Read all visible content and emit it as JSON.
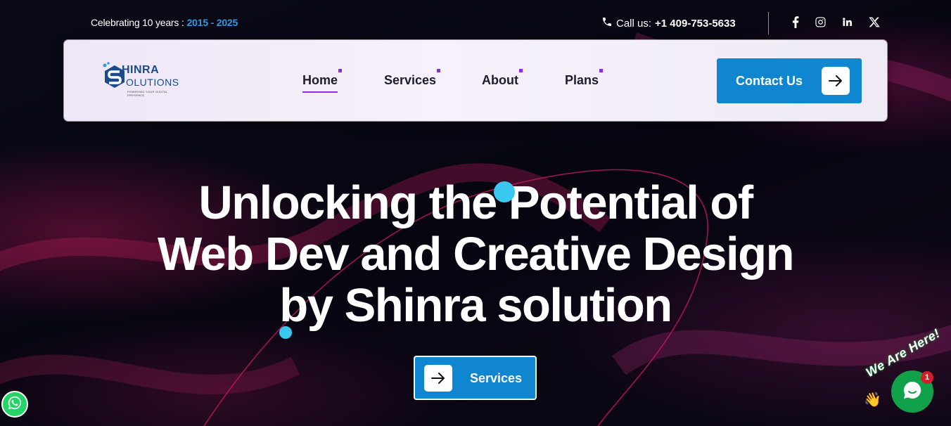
{
  "topbar": {
    "celebrate_text": "Celebrating 10 years :",
    "celebrate_years": "2015 - 2025",
    "call_label": "Call us:",
    "call_number": "+1 409-753-5633"
  },
  "social": {
    "facebook": "facebook-icon",
    "instagram": "instagram-icon",
    "linkedin": "linkedin-icon",
    "x": "x-icon"
  },
  "logo": {
    "line1": "HINRA",
    "line2": "OLUTIONS",
    "tagline": "POWERING YOUR DIGITAL PRESENCE"
  },
  "nav": {
    "items": [
      {
        "label": "Home",
        "active": true
      },
      {
        "label": "Services",
        "active": false
      },
      {
        "label": "About",
        "active": false
      },
      {
        "label": "Plans",
        "active": false
      }
    ],
    "cta_label": "Contact Us"
  },
  "hero": {
    "line1": "Unlocking the Potential of",
    "line2": "Web Dev and Creative Design",
    "line3": "by Shinra solution",
    "button_label": "Services"
  },
  "chat": {
    "badge_count": "1",
    "banner": "We Are Here!"
  },
  "colors": {
    "accent_blue": "#0f86cf",
    "nav_dot_purple": "#8a2ee0",
    "years_blue": "#2f9be0",
    "cyan_dot": "#38c8f0",
    "whatsapp_green": "#25d366",
    "chat_green": "#11a14a"
  }
}
